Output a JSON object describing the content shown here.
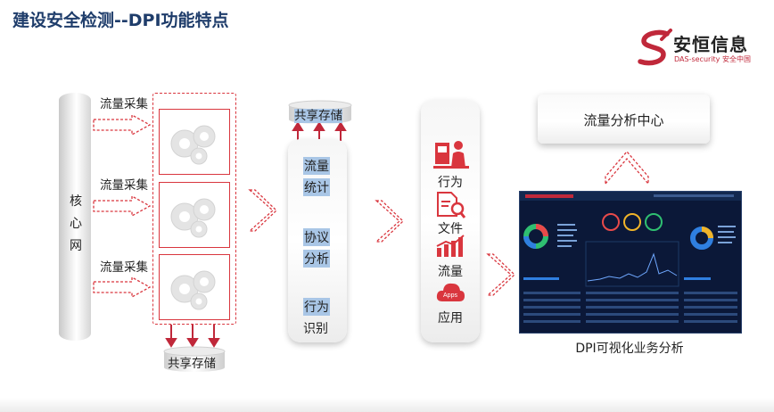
{
  "title": "建设安全检测--DPI功能特点",
  "logo": {
    "name": "安恒信息",
    "subtitle": "DAS-security 安全中国"
  },
  "core": [
    "核",
    "心",
    "网"
  ],
  "collect": [
    "流量采集",
    "流量采集",
    "流量采集"
  ],
  "storage_top": "共享存储",
  "storage_bottom": "共享存储",
  "process": [
    {
      "line1": "流量",
      "line2": "统计"
    },
    {
      "line1": "协议",
      "line2": "分析"
    },
    {
      "line1": "行为",
      "line2": "识别"
    }
  ],
  "categories": [
    "行为",
    "文件",
    "流量",
    "应用"
  ],
  "apps_badge": "Apps",
  "center": "流量分析中心",
  "dashboard_caption": "DPI可视化业务分析",
  "colors": {
    "accent_red": "#d9363e",
    "title_blue": "#1f3d6b",
    "highlight_blue": "#a9c6e6",
    "dashboard_bg": "#0b1838"
  }
}
